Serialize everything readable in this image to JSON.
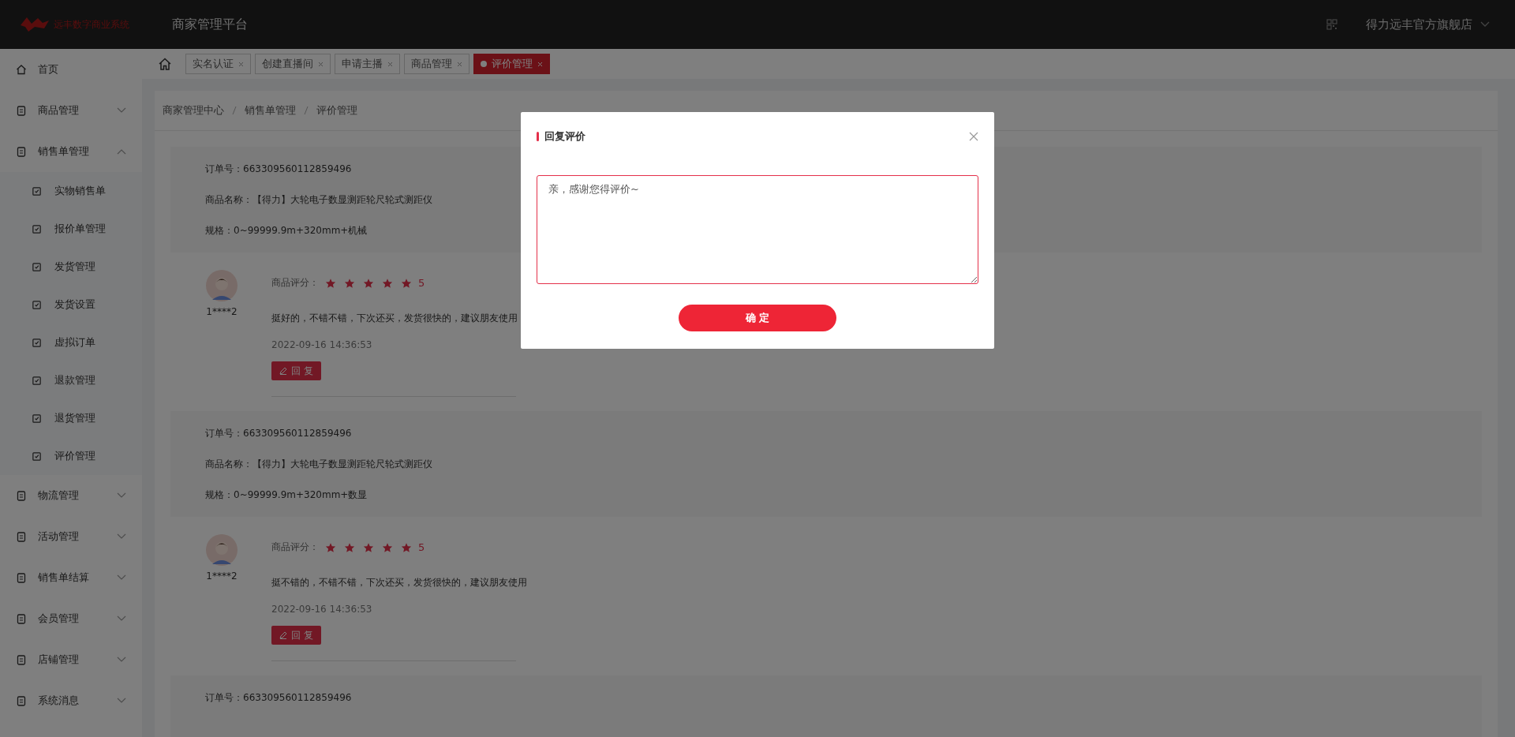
{
  "header": {
    "logo_text": "远丰数字商业系统",
    "platform_title": "商家管理平台",
    "store_name": "得力远丰官方旗舰店"
  },
  "sidebar": {
    "items": [
      {
        "label": "首页",
        "kind": "link"
      },
      {
        "label": "商品管理",
        "kind": "group",
        "expanded": false
      },
      {
        "label": "销售单管理",
        "kind": "group",
        "expanded": true,
        "children": [
          {
            "label": "实物销售单"
          },
          {
            "label": "报价单管理"
          },
          {
            "label": "发货管理"
          },
          {
            "label": "发货设置"
          },
          {
            "label": "虚拟订单"
          },
          {
            "label": "退款管理"
          },
          {
            "label": "退货管理"
          },
          {
            "label": "评价管理"
          }
        ]
      },
      {
        "label": "物流管理",
        "kind": "group",
        "expanded": false
      },
      {
        "label": "活动管理",
        "kind": "group",
        "expanded": false
      },
      {
        "label": "销售单结算",
        "kind": "group",
        "expanded": false
      },
      {
        "label": "会员管理",
        "kind": "group",
        "expanded": false
      },
      {
        "label": "店铺管理",
        "kind": "group",
        "expanded": false
      },
      {
        "label": "系统消息",
        "kind": "group",
        "expanded": false
      }
    ]
  },
  "tabs": [
    {
      "label": "实名认证",
      "selected": false
    },
    {
      "label": "创建直播间",
      "selected": false
    },
    {
      "label": "申请主播",
      "selected": false
    },
    {
      "label": "商品管理",
      "selected": false
    },
    {
      "label": "评价管理",
      "selected": true
    }
  ],
  "breadcrumb": [
    "商家管理中心",
    "销售单管理",
    "评价管理"
  ],
  "orders": [
    {
      "order_number": "订单号：663309560112859496",
      "product_name": "商品名称：【得力】大轮电子数显测距轮尺轮式测距仪",
      "spec": "规格：0~99999.9m+320mm+机械",
      "review": {
        "user": "1****2",
        "rating_label": "商品评分：",
        "stars": 5,
        "rating": "5",
        "comment": "挺好的，不错不错，下次还买，发货很快的，建议朋友使用",
        "time": "2022-09-16 14:36:53",
        "reply_button": "回 复"
      }
    },
    {
      "order_number": "订单号：663309560112859496",
      "product_name": "商品名称：【得力】大轮电子数显测距轮尺轮式测距仪",
      "spec": "规格：0~99999.9m+320mm+数显",
      "review": {
        "user": "1****2",
        "rating_label": "商品评分：",
        "stars": 5,
        "rating": "5",
        "comment": "挺不错的，不错不错，下次还买，发货很快的，建议朋友使用",
        "time": "2022-09-16 14:36:53",
        "reply_button": "回 复"
      }
    },
    {
      "order_number": "订单号：663309560112859496"
    }
  ],
  "modal": {
    "title": "回复评价",
    "reply_text": "亲，感谢您得评价~",
    "confirm_button": "确 定"
  }
}
